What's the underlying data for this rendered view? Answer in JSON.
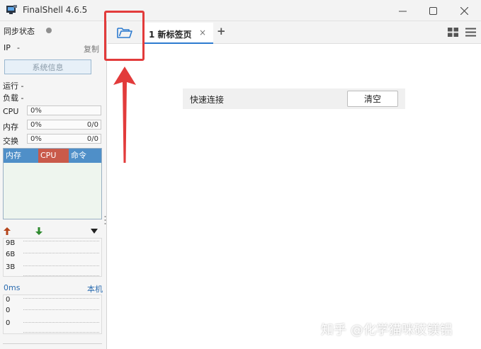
{
  "window": {
    "title": "FinalShell 4.6.5",
    "icon": "finalshell-app-icon",
    "controls": [
      "minimize-icon",
      "maximize-icon",
      "close-icon"
    ]
  },
  "sidebar": {
    "sync_label": "同步状态",
    "sync_status_color": "#8f8f8f",
    "ip_label": "IP",
    "ip_value": "-",
    "copy_label": "复制",
    "sysinfo_button": "系统信息",
    "running_label": "运行 -",
    "load_label": "负载 -",
    "meters": [
      {
        "label": "CPU",
        "percent": "0%",
        "ratio": ""
      },
      {
        "label": "内存",
        "percent": "0%",
        "ratio": "0/0"
      },
      {
        "label": "交换",
        "percent": "0%",
        "ratio": "0/0"
      }
    ],
    "process_table": {
      "columns": [
        "内存",
        "CPU",
        "命令"
      ],
      "column_colors": [
        "#4f8fc8",
        "#c95a4a",
        "#4f8fc8"
      ]
    },
    "network": {
      "up_icon": "arrow-up-icon",
      "down_icon": "arrow-down-icon",
      "menu_icon": "triangle-down-icon",
      "y_labels": [
        "9B",
        "6B",
        "3B"
      ]
    },
    "latency": {
      "ms_label": "0ms",
      "host_label": "本机",
      "y_labels": [
        "0",
        "0",
        "0"
      ]
    }
  },
  "tabs": {
    "open_folder_icon": "folder-open-icon",
    "items": [
      {
        "label": "1 新标签页",
        "close": "×"
      }
    ],
    "add_label": "+",
    "right_icons": [
      "grid-view-icon",
      "hamburger-menu-icon"
    ]
  },
  "main": {
    "quick_connect_label": "快速连接",
    "clear_button": "清空"
  },
  "annotation": {
    "box_color": "#e23b3b",
    "arrow_color": "#e23b3b"
  },
  "watermark": "知乎 @化学猫咪砹镁铝",
  "colors": {
    "accent": "#2d7bd0",
    "mem_header": "#4f8fc8",
    "cpu_header": "#c95a4a",
    "highlight": "#e23b3b"
  }
}
